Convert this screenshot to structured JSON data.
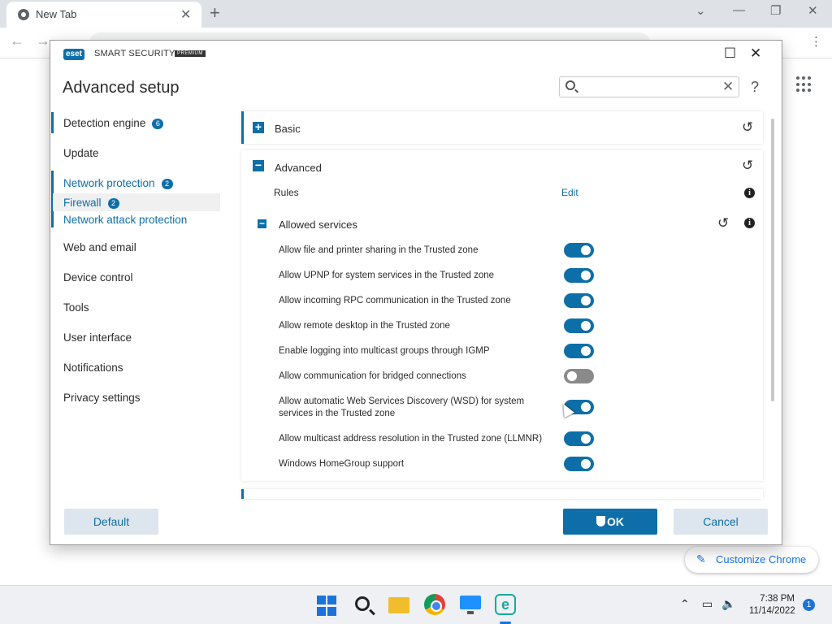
{
  "browser": {
    "tab_title": "New Tab",
    "customize_label": "Customize Chrome"
  },
  "dialog": {
    "logo_text": "eset",
    "product_name": "SMART SECURITY",
    "edition_badge": "PREMIUM",
    "page_title": "Advanced setup",
    "search_placeholder": "",
    "help_label": "?"
  },
  "sidebar": {
    "items": [
      {
        "label": "Detection engine",
        "badge": "6"
      },
      {
        "label": "Update"
      },
      {
        "label": "Network protection",
        "badge": "2"
      },
      {
        "label": "Firewall",
        "badge": "2"
      },
      {
        "label": "Network attack protection"
      },
      {
        "label": "Web and email"
      },
      {
        "label": "Device control"
      },
      {
        "label": "Tools"
      },
      {
        "label": "User interface"
      },
      {
        "label": "Notifications"
      },
      {
        "label": "Privacy settings"
      }
    ]
  },
  "content": {
    "basic_title": "Basic",
    "advanced_title": "Advanced",
    "rules_label": "Rules",
    "edit_link": "Edit",
    "allowed_services_title": "Allowed services",
    "services": [
      {
        "label": "Allow file and printer sharing in the Trusted zone",
        "enabled": true
      },
      {
        "label": "Allow UPNP for system services in the Trusted zone",
        "enabled": true
      },
      {
        "label": "Allow incoming RPC communication in the Trusted zone",
        "enabled": true
      },
      {
        "label": "Allow remote desktop in the Trusted zone",
        "enabled": true
      },
      {
        "label": "Enable logging into multicast groups through IGMP",
        "enabled": true
      },
      {
        "label": "Allow communication for bridged connections",
        "enabled": false
      },
      {
        "label": "Allow automatic Web Services Discovery (WSD) for system services in the Trusted zone",
        "enabled": true
      },
      {
        "label": "Allow multicast address resolution in the Trusted zone (LLMNR)",
        "enabled": true
      },
      {
        "label": "Windows HomeGroup support",
        "enabled": true
      }
    ]
  },
  "footer": {
    "default_label": "Default",
    "ok_label": "OK",
    "cancel_label": "Cancel"
  },
  "taskbar": {
    "time": "7:38 PM",
    "date": "11/14/2022",
    "notification_count": "1"
  },
  "colors": {
    "accent": "#0e6fa8",
    "toggle_off": "#8a8a8a"
  }
}
